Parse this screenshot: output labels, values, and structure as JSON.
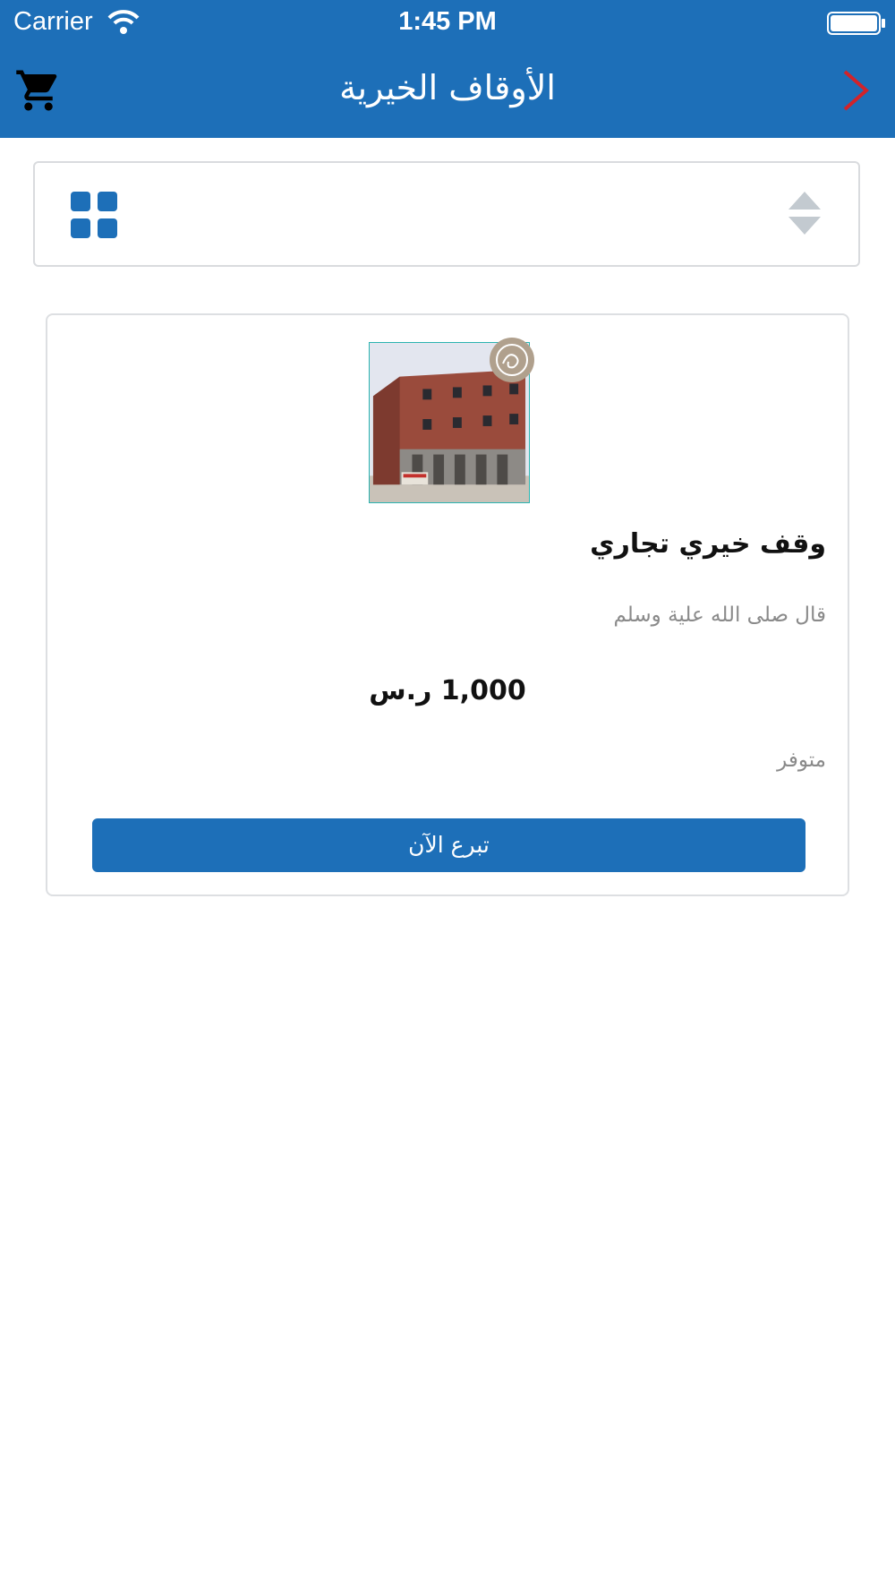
{
  "status_bar": {
    "carrier": "Carrier",
    "time": "1:45 PM"
  },
  "nav": {
    "title": "الأوقاف الخيرية",
    "left_icon": "cart-icon",
    "right_icon": "chevron-right-icon"
  },
  "toolbar": {
    "left_icon": "grid-view-icon",
    "right_icon": "sort-icon"
  },
  "product": {
    "image": "building-photo",
    "badge_icon": "waqf-calligraphy-badge-icon",
    "title": "وقف خيري تجاري",
    "description": "قال صلى الله علية وسلم",
    "price": "1,000 ر.س",
    "status": "متوفر",
    "button_label": "تبرع الآن"
  },
  "colors": {
    "primary": "#1d6fb8",
    "back_chevron": "#d2232a",
    "muted_text": "#8a8a8a",
    "border": "#dddfe2"
  }
}
